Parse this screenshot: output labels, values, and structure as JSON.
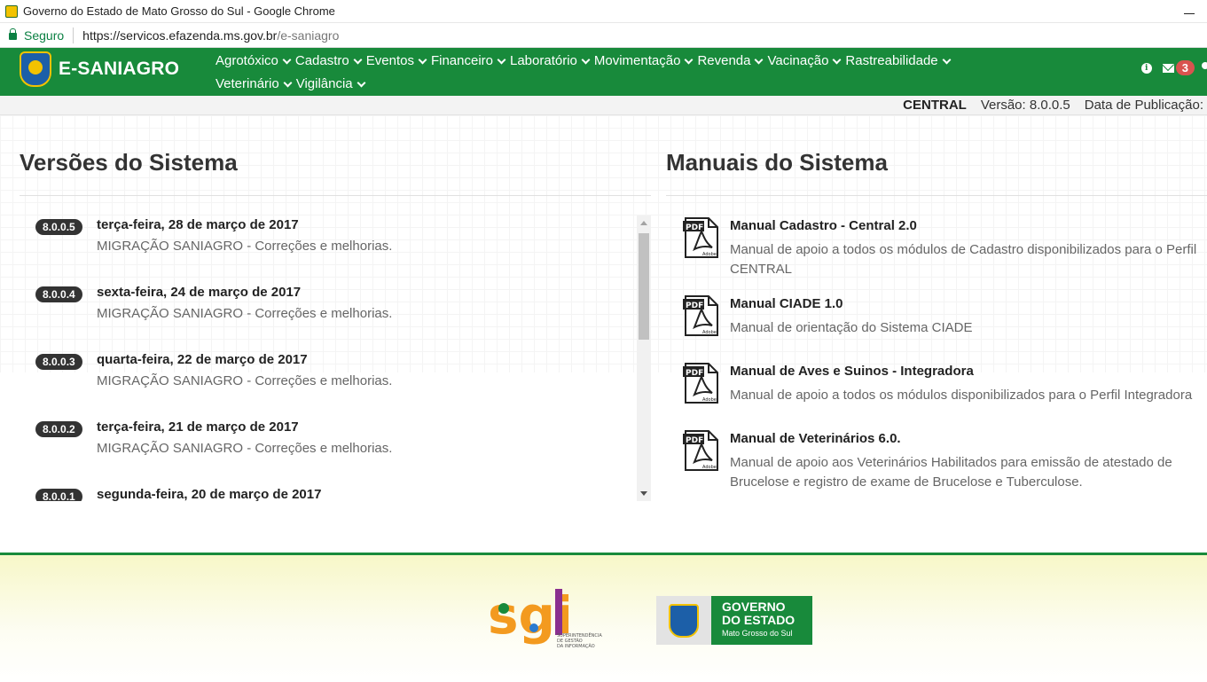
{
  "browser": {
    "window_title": "Governo do Estado de Mato Grosso do Sul - Google Chrome",
    "secure_label": "Seguro",
    "url_host": "https://servicos.efazenda.ms.gov.br",
    "url_path": "/e-saniagro"
  },
  "navbar": {
    "brand": "E-SANIAGRO",
    "menu": [
      {
        "label": "Agrotóxico"
      },
      {
        "label": "Cadastro"
      },
      {
        "label": "Eventos"
      },
      {
        "label": "Financeiro"
      },
      {
        "label": "Laboratório"
      },
      {
        "label": "Movimentação"
      },
      {
        "label": "Revenda"
      },
      {
        "label": "Vacinação"
      },
      {
        "label": "Rastreabilidade"
      },
      {
        "label": "Veterinário"
      },
      {
        "label": "Vigilância"
      }
    ],
    "notification_count": "3",
    "icons": [
      "info-icon",
      "mail-icon",
      "user-icon"
    ]
  },
  "status": {
    "profile": "CENTRAL",
    "version": "Versão: 8.0.0.5",
    "publication": "Data de Publicação:"
  },
  "versions": {
    "title": "Versões do Sistema",
    "items": [
      {
        "badge": "8.0.0.5",
        "date": "terça-feira, 28 de março de 2017",
        "desc": "MIGRAÇÃO SANIAGRO - Correções e melhorias."
      },
      {
        "badge": "8.0.0.4",
        "date": "sexta-feira, 24 de março de 2017",
        "desc": "MIGRAÇÃO SANIAGRO - Correções e melhorias."
      },
      {
        "badge": "8.0.0.3",
        "date": "quarta-feira, 22 de março de 2017",
        "desc": "MIGRAÇÃO SANIAGRO - Correções e melhorias."
      },
      {
        "badge": "8.0.0.2",
        "date": "terça-feira, 21 de março de 2017",
        "desc": "MIGRAÇÃO SANIAGRO - Correções e melhorias."
      },
      {
        "badge": "8.0.0.1",
        "date": "segunda-feira, 20 de março de 2017",
        "desc": ""
      }
    ]
  },
  "manuals": {
    "title": "Manuais do Sistema",
    "items": [
      {
        "title": "Manual Cadastro - Central 2.0",
        "desc": "Manual de apoio a todos os módulos de Cadastro disponibilizados para o Perfil CENTRAL"
      },
      {
        "title": "Manual CIADE 1.0",
        "desc": "Manual de orientação do Sistema CIADE"
      },
      {
        "title": "Manual de Aves e Suinos - Integradora",
        "desc": "Manual de apoio a todos os módulos disponibilizados para o Perfil Integradora"
      },
      {
        "title": "Manual de Veterinários 6.0.",
        "desc": "Manual de apoio aos Veterinários Habilitados para emissão de atestado de Brucelose e registro de exame de Brucelose e Tuberculose."
      }
    ],
    "pdf_label": "PDF",
    "adobe_label": "Adobe"
  },
  "footer": {
    "sgi_logo_text": "sgi",
    "sgi_subtitle": [
      "SUPERINTENDÊNCIA",
      "DE GESTÃO",
      "DA INFORMAÇÃO"
    ],
    "gov_line1": "GOVERNO",
    "gov_line2": "DO ESTADO",
    "gov_line3": "Mato Grosso do Sul"
  },
  "colors": {
    "brand_green": "#188a3b",
    "badge_red": "#d9534f",
    "version_badge": "#333333"
  }
}
